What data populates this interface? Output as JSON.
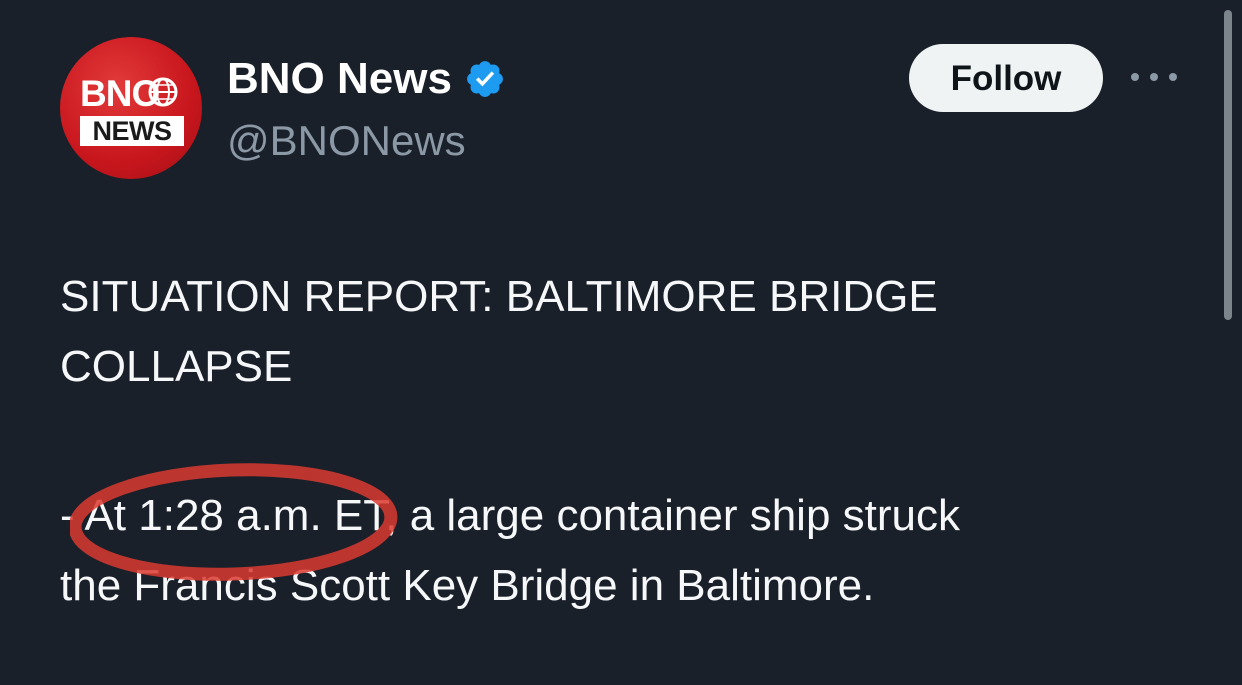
{
  "author": {
    "display_name": "BNO News",
    "handle": "@BNONews",
    "avatar": {
      "top_text": "BNO",
      "bottom_text": "NEWS"
    },
    "verified": true
  },
  "follow_button": {
    "label": "Follow"
  },
  "more_menu": {
    "icon": "more-horizontal-icon"
  },
  "tweet": {
    "headline_line1": "SITUATION REPORT: BALTIMORE BRIDGE",
    "headline_line2": "COLLAPSE",
    "body_line1": "- At 1:28 a.m. ET, a large container ship struck",
    "body_line2": "the Francis Scott Key Bridge in Baltimore."
  },
  "colors": {
    "background": "#1a202a",
    "text": "#f5f7f8",
    "handle": "#8b98a5",
    "verified": "#1d9bf0",
    "avatar_red": "#c8161d",
    "annotation_red": "#d93a2f"
  }
}
